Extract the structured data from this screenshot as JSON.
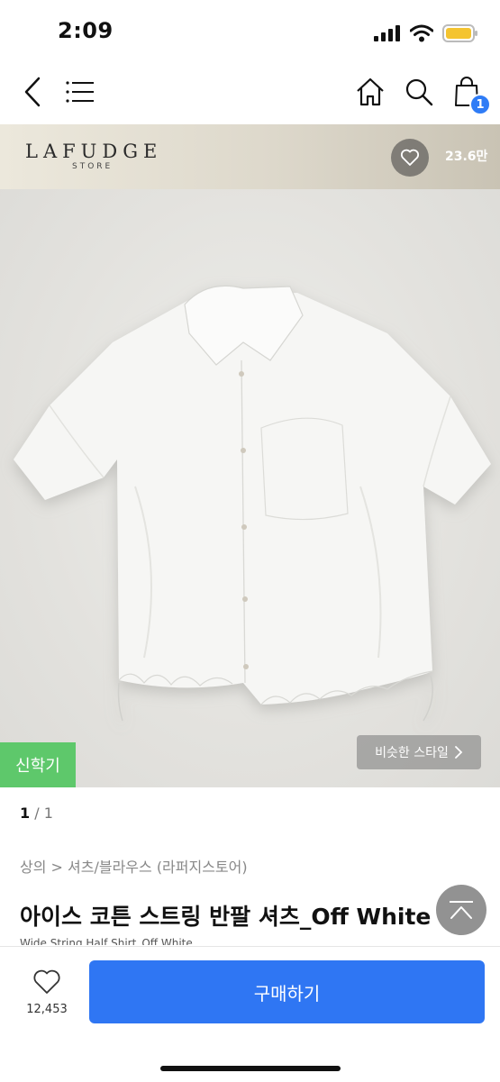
{
  "status_bar": {
    "time": "2:09"
  },
  "nav": {
    "cart_count": "1"
  },
  "store": {
    "name": "LAFUDGE",
    "sub": "STORE",
    "like_count": "23.6만"
  },
  "product": {
    "badge_new": "신학기",
    "similar_style": "비슷한 스타일",
    "pager_current": "1",
    "pager_total": "1",
    "breadcrumb": "상의 > 셔츠/블라우스 (라퍼지스토어)",
    "title": "아이스 코튼 스트링 반팔 셔츠_Off White",
    "subtitle": "Wide String Half Shirt_Off White"
  },
  "bottom": {
    "wish_count": "12,453",
    "buy_label": "구매하기"
  },
  "colors": {
    "accent": "#2f76f3",
    "badge_green": "#5ec86b",
    "cart_badge": "#2f7cf6"
  }
}
